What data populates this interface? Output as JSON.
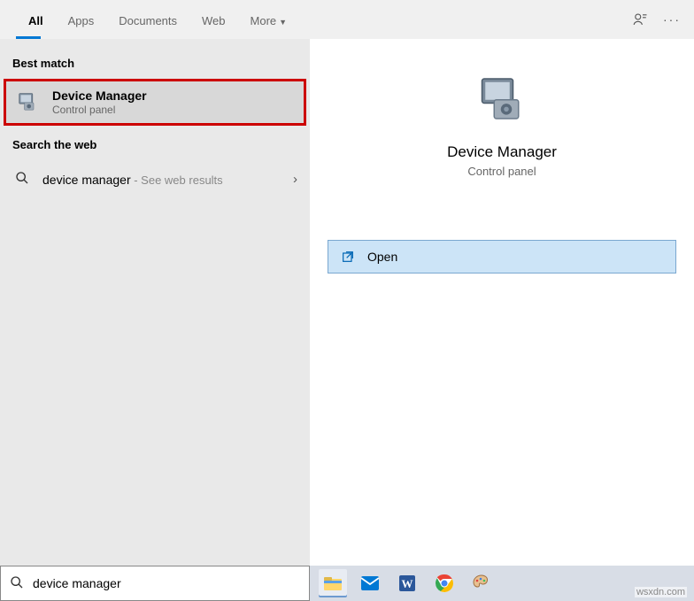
{
  "tabs": [
    "All",
    "Apps",
    "Documents",
    "Web",
    "More"
  ],
  "section_best": "Best match",
  "best_result": {
    "title": "Device Manager",
    "subtitle": "Control panel"
  },
  "section_web": "Search the web",
  "web_result": {
    "query": "device manager",
    "hint": " - See web results"
  },
  "preview": {
    "title": "Device Manager",
    "subtitle": "Control panel",
    "open_label": "Open"
  },
  "search_value": "device manager",
  "watermark": "wsxdn.com"
}
